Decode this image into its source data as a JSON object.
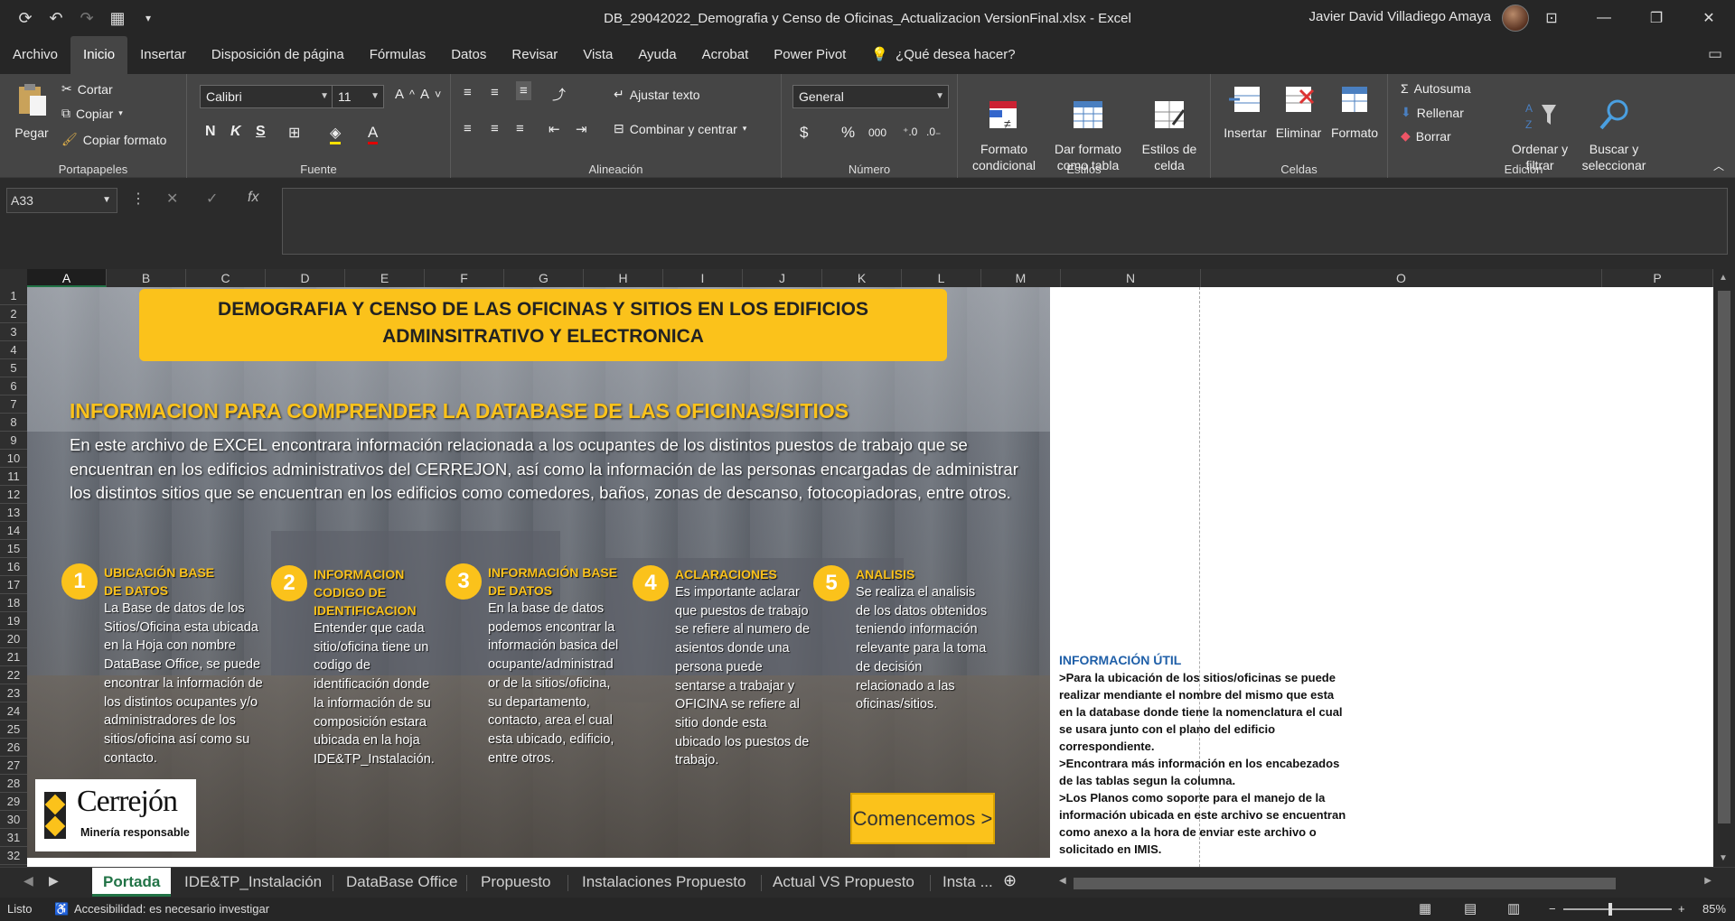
{
  "window": {
    "title": "DB_29042022_Demografia y Censo de Oficinas_Actualizacion VersionFinal.xlsx  -  Excel",
    "user": "Javier David Villadiego Amaya"
  },
  "menu": {
    "tabs": [
      "Archivo",
      "Inicio",
      "Insertar",
      "Disposición de página",
      "Fórmulas",
      "Datos",
      "Revisar",
      "Vista",
      "Ayuda",
      "Acrobat",
      "Power Pivot"
    ],
    "help": "¿Qué desea hacer?"
  },
  "ribbon": {
    "clipboard": {
      "paste": "Pegar",
      "cut": "Cortar",
      "copy": "Copiar",
      "format_painter": "Copiar formato",
      "label": "Portapapeles"
    },
    "font": {
      "name": "Calibri",
      "size": "11",
      "label": "Fuente",
      "bold": "N",
      "italic": "K",
      "underline": "S"
    },
    "alignment": {
      "wrap": "Ajustar texto",
      "merge": "Combinar y centrar",
      "label": "Alineación"
    },
    "number": {
      "format": "General",
      "label": "Número",
      "currency": "$",
      "percent": "%",
      "thousands": "000"
    },
    "styles": {
      "cond": "Formato\ncondicional",
      "table": "Dar formato\ncomo tabla",
      "cell": "Estilos de\ncelda",
      "label": "Estilos"
    },
    "cells": {
      "insert": "Insertar",
      "delete": "Eliminar",
      "format": "Formato",
      "label": "Celdas"
    },
    "editing": {
      "autosum": "Autosuma",
      "fill": "Rellenar",
      "clear": "Borrar",
      "sort": "Ordenar y\nfiltrar",
      "find": "Buscar y\nseleccionar",
      "label": "Edición"
    }
  },
  "formula_bar": {
    "name_box": "A33",
    "fx": "fx",
    "value": ""
  },
  "columns": [
    "A",
    "B",
    "C",
    "D",
    "E",
    "F",
    "G",
    "H",
    "I",
    "J",
    "K",
    "L",
    "M",
    "N",
    "O",
    "P"
  ],
  "rows": [
    "1",
    "2",
    "3",
    "4",
    "5",
    "6",
    "7",
    "8",
    "9",
    "10",
    "11",
    "12",
    "13",
    "14",
    "15",
    "16",
    "17",
    "18",
    "19",
    "20",
    "21",
    "22",
    "23",
    "24",
    "25",
    "26",
    "27",
    "28",
    "29",
    "30",
    "31",
    "32"
  ],
  "content": {
    "banner_title": "DEMOGRAFIA Y CENSO DE LAS OFICINAS Y SITIOS EN LOS EDIFICIOS ADMINSITRATIVO Y ELECTRONICA",
    "info_title": "INFORMACION PARA COMPRENDER LA DATABASE DE LAS OFICINAS/SITIOS",
    "info_text": "En este archivo de EXCEL encontrara información relacionada a los ocupantes de los distintos puestos de trabajo que se encuentran en los edificios administrativos del CERREJON, así como la información de las personas encargadas de administrar los distintos sitios que se encuentran en los edificios como comedores, baños, zonas de descanso, fotocopiadoras, entre otros.",
    "steps": [
      {
        "num": "1",
        "title": "UBICACIÓN BASE DE DATOS",
        "body": "La Base de datos de los Sitios/Oficina esta ubicada en la Hoja con nombre DataBase Office, se puede encontrar la información de los distintos ocupantes y/o administradores de los sitios/oficina así como su contacto."
      },
      {
        "num": "2",
        "title": "INFORMACION CODIGO DE IDENTIFICACION",
        "body": "Entender que cada sitio/oficina tiene un codigo de identificación donde la información de su composición estara ubicada en la hoja IDE&TP_Instalación."
      },
      {
        "num": "3",
        "title": "INFORMACIÓN BASE DE DATOS",
        "body": "En la base de datos podemos encontrar la información basica del ocupante/administrad or de la sitios/oficina, su departamento, contacto, area el cual esta ubicado, edificio, entre otros."
      },
      {
        "num": "4",
        "title": "ACLARACIONES",
        "body": "Es importante aclarar que puestos de trabajo se refiere al numero de asientos donde una persona puede sentarse a trabajar y OFICINA se refiere al sitio donde esta ubicado los puestos de trabajo."
      },
      {
        "num": "5",
        "title": "ANALISIS",
        "body": "Se realiza el analisis de los datos obtenidos teniendo información relevante para la toma de decisión relacionado a las oficinas/sitios."
      }
    ],
    "logo_brand": "Cerrejón",
    "logo_tag": "Minería responsable",
    "cta": "Comencemos >",
    "util_title": "INFORMACIÓN ÚTIL",
    "util_body": ">Para la ubicación de los sitios/oficinas se puede realizar mendiante el nombre del mismo que esta en la database donde tiene la nomenclatura el cual se usara junto con el plano del edificio correspondiente.\n>Encontrara más información en los encabezados de las tablas segun la columna.\n>Los Planos como soporte para el manejo de la información ubicada en este archivo se encuentran como anexo a la hora de enviar este archivo o solicitado en IMIS."
  },
  "sheets": [
    "Portada",
    "IDE&TP_Instalación",
    "DataBase Office",
    "Propuesto",
    "Instalaciones Propuesto",
    "Actual VS Propuesto",
    "Insta ..."
  ],
  "status": {
    "ready": "Listo",
    "accessibility": "Accesibilidad: es necesario investigar",
    "zoom": "85%"
  },
  "colors": {
    "accent": "#fbc21b",
    "excel_green": "#217346",
    "util_blue": "#1f5fa8"
  }
}
